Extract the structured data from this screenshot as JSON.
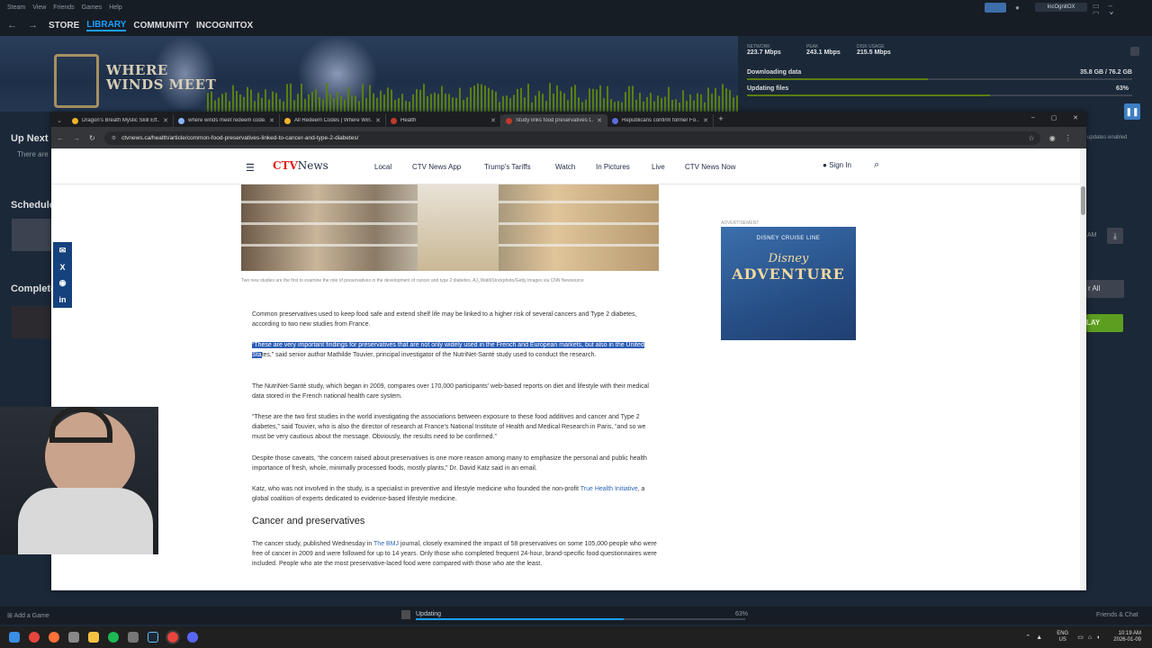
{
  "steam": {
    "menubar": [
      "Steam",
      "View",
      "Friends",
      "Games",
      "Help"
    ],
    "nav": {
      "store": "STORE",
      "library": "LIBRARY",
      "community": "COMMUNITY",
      "username": "INCOGNITOX"
    },
    "user_pill": "IncOgnitOX",
    "banner_title_line1": "WHERE",
    "banner_title_line2": "WINDS MEET",
    "downloads": {
      "network_label": "NETWORK",
      "network_value": "223.7 Mbps",
      "peak_label": "PEAK",
      "peak_value": "243.1 Mbps",
      "disk_label": "DISK USAGE",
      "disk_value": "215.5 Mbps",
      "downloading_label": "Downloading data",
      "downloading_size": "35.8 GB / 76.2 GB",
      "downloading_progress": 0.47,
      "updating_label": "Updating files",
      "updating_percent": "63%",
      "updating_progress": 0.63,
      "updates_enabled": "updates enabled"
    },
    "sidebar": {
      "up_next": "Up Next",
      "there_are": "There are",
      "scheduled": "Schedule",
      "completed": "Complete"
    },
    "right": {
      "time_fragment": "AM",
      "clear_all": "r All",
      "play": "LAY"
    },
    "bottom": {
      "add_game": "Add a Game",
      "updating": "Updating",
      "updating_percent": "63%",
      "updating_progress": 0.63,
      "friends_chat": "Friends & Chat"
    }
  },
  "chrome": {
    "tabs": [
      {
        "label": "Dragon's Breath Mystic Skill Eff...",
        "color": "#f0b429"
      },
      {
        "label": "where winds meet redeem code...",
        "color": "#8ab4f8"
      },
      {
        "label": "All Redeem Codes | Where Win...",
        "color": "#f0b429"
      },
      {
        "label": "Health",
        "color": "#c0392b"
      },
      {
        "label": "Study links food preservatives t...",
        "color": "#c0392b"
      },
      {
        "label": "Republicans confirm former Fo...",
        "color": "#5b6bd6"
      }
    ],
    "new_tab": "+",
    "url": "ctvnews.ca/health/article/common-food-preservatives-linked-to-cancer-and-type-2-diabetes/"
  },
  "ctv": {
    "logo_ctv": "CTV",
    "logo_news": "News",
    "nav": [
      "Local",
      "CTV News App",
      "Trump's Tariffs",
      "Watch",
      "In Pictures",
      "Live",
      "CTV News Now"
    ],
    "sign_in": "Sign In",
    "caption": "Two new studies are the first to examine the role of preservatives in the development of cancer and type 2 diabetes. AJ_Watt/iStockphoto/Getty Images via CNN Newsource",
    "advertisement": "ADVERTISEMENT",
    "ad_line1": "DISNEY CRUISE LINE",
    "ad_line2": "Disney",
    "ad_line3": "ADVENTURE",
    "p1": "Common preservatives used to keep food safe and extend shelf life may be linked to a higher risk of several cancers and Type 2 diabetes, according to two new studies from France.",
    "p2_highlight": "“These are very important findings for preservatives that are not only widely used in the French and European markets, but also in the United Sta",
    "p2_rest": "tes,” said senior author Mathilde Touvier, principal investigator of the NutriNet-Santé study used to conduct the research.",
    "p3": "The NutriNet-Santé study, which began in 2009, compares over 170,000 participants' web-based reports on diet and lifestyle with their medical data stored in the French national health care system.",
    "p4": "“These are the two first studies in the world investigating the associations between exposure to these food additives and cancer and Type 2 diabetes,” said Touvier, who is also the director of research at France's National Institute of Health and Medical Research in Paris, “and so we must be very cautious about the message. Obviously, the results need to be confirmed.”",
    "p5": "Despite those caveats, “the concern raised about preservatives is one more reason among many to emphasize the personal and public health importance of fresh, whole, minimally processed foods, mostly plants,” Dr. David Katz said in an email.",
    "p6_a": "Katz, who was not involved in the study, is a specialist in preventive and lifestyle medicine who founded the non-profit ",
    "p6_link": "True Health Initiative",
    "p6_b": ", a global coalition of experts dedicated to evidence-based lifestyle medicine.",
    "h2": "Cancer and preservatives",
    "p7_a": "The cancer study, published Wednesday in ",
    "p7_link": "The BMJ",
    "p7_b": " journal, closely examined the impact of 58 preservatives on some 105,000 people who were free of cancer in 2009 and were followed for up to 14 years. Only those who completed frequent 24-hour, brand-specific food questionnaires were included. People who ate the most preservative-laced food were compared with those who ate the least."
  },
  "taskbar": {
    "lang1": "ENG",
    "lang2": "US",
    "time": "10:19 AM",
    "date": "2026-01-09"
  }
}
